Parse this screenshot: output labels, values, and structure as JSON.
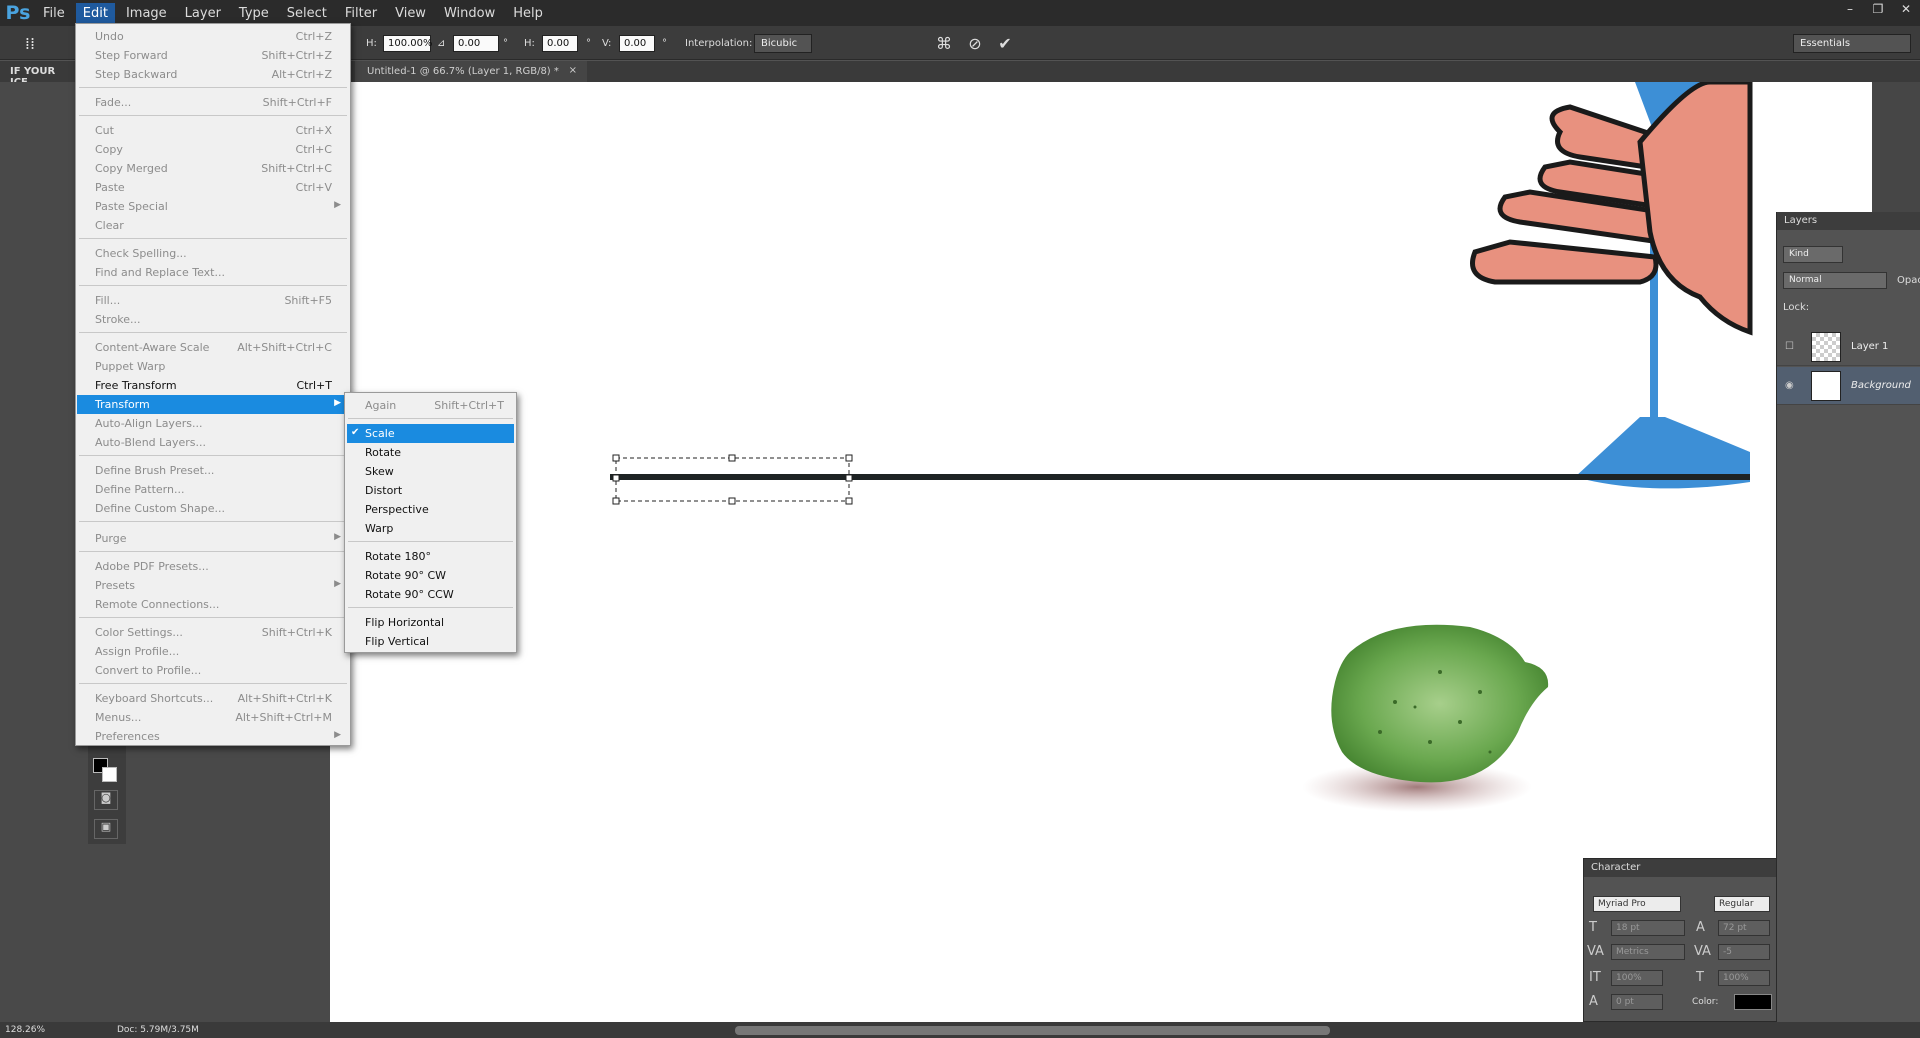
{
  "menubar": {
    "logo": "Ps",
    "items": [
      "File",
      "Edit",
      "Image",
      "Layer",
      "Type",
      "Select",
      "Filter",
      "View",
      "Window",
      "Help"
    ],
    "active": "Edit",
    "window_controls": [
      "–",
      "❐",
      "✕"
    ]
  },
  "options": {
    "h_label": "H:",
    "h_value": "100.00%",
    "angle_symbol": "⊿",
    "angle_value": "0.00",
    "degree": "°",
    "hskew_label": "H:",
    "hskew_value": "0.00",
    "vskew_label": "V:",
    "vskew_value": "0.00",
    "interpolation_label": "Interpolation:",
    "interpolation_value": "Bicubic",
    "workspace": "Essentials"
  },
  "left_panel_title": "IF YOUR ICE",
  "document_tab": "Untitled-1 @ 66.7% (Layer 1, RGB/8) *",
  "document_tab_close": "×",
  "edit_menu": {
    "items": [
      {
        "label": "Undo",
        "shortcut": "Ctrl+Z"
      },
      {
        "label": "Step Forward",
        "shortcut": "Shift+Ctrl+Z"
      },
      {
        "label": "Step Backward",
        "shortcut": "Alt+Ctrl+Z"
      },
      {
        "label": "Fade...",
        "shortcut": "Shift+Ctrl+F"
      },
      {
        "label": "Cut",
        "shortcut": "Ctrl+X"
      },
      {
        "label": "Copy",
        "shortcut": "Ctrl+C"
      },
      {
        "label": "Copy Merged",
        "shortcut": "Shift+Ctrl+C"
      },
      {
        "label": "Paste",
        "shortcut": "Ctrl+V"
      },
      {
        "label": "Paste Special",
        "shortcut": ""
      },
      {
        "label": "Clear",
        "shortcut": ""
      },
      {
        "label": "Check Spelling...",
        "shortcut": ""
      },
      {
        "label": "Find and Replace Text...",
        "shortcut": ""
      },
      {
        "label": "Fill...",
        "shortcut": "Shift+F5"
      },
      {
        "label": "Stroke...",
        "shortcut": ""
      },
      {
        "label": "Content-Aware Scale",
        "shortcut": "Alt+Shift+Ctrl+C"
      },
      {
        "label": "Puppet Warp",
        "shortcut": ""
      },
      {
        "label": "Free Transform",
        "shortcut": "Ctrl+T"
      },
      {
        "label": "Transform",
        "shortcut": ""
      },
      {
        "label": "Auto-Align Layers...",
        "shortcut": ""
      },
      {
        "label": "Auto-Blend Layers...",
        "shortcut": ""
      },
      {
        "label": "Define Brush Preset...",
        "shortcut": ""
      },
      {
        "label": "Define Pattern...",
        "shortcut": ""
      },
      {
        "label": "Define Custom Shape...",
        "shortcut": ""
      },
      {
        "label": "Purge",
        "shortcut": ""
      },
      {
        "label": "Adobe PDF Presets...",
        "shortcut": ""
      },
      {
        "label": "Presets",
        "shortcut": ""
      },
      {
        "label": "Remote Connections...",
        "shortcut": ""
      },
      {
        "label": "Color Settings...",
        "shortcut": "Shift+Ctrl+K"
      },
      {
        "label": "Assign Profile...",
        "shortcut": ""
      },
      {
        "label": "Convert to Profile...",
        "shortcut": ""
      },
      {
        "label": "Keyboard Shortcuts...",
        "shortcut": "Alt+Shift+Ctrl+K"
      },
      {
        "label": "Menus...",
        "shortcut": "Alt+Shift+Ctrl+M"
      },
      {
        "label": "Preferences",
        "shortcut": ""
      }
    ]
  },
  "transform_menu": {
    "items": [
      {
        "label": "Again",
        "shortcut": "Shift+Ctrl+T"
      },
      {
        "label": "Scale",
        "shortcut": ""
      },
      {
        "label": "Rotate",
        "shortcut": ""
      },
      {
        "label": "Skew",
        "shortcut": ""
      },
      {
        "label": "Distort",
        "shortcut": ""
      },
      {
        "label": "Perspective",
        "shortcut": ""
      },
      {
        "label": "Warp",
        "shortcut": ""
      },
      {
        "label": "Rotate 180°",
        "shortcut": ""
      },
      {
        "label": "Rotate 90° CW",
        "shortcut": ""
      },
      {
        "label": "Rotate 90° CCW",
        "shortcut": ""
      },
      {
        "label": "Flip Horizontal",
        "shortcut": ""
      },
      {
        "label": "Flip Vertical",
        "shortcut": ""
      }
    ],
    "checked": "Scale"
  },
  "layers_panel": {
    "title": "Layers",
    "kind": "Kind",
    "blend_mode": "Normal",
    "opacity_label": "Opac",
    "lock_label": "Lock:",
    "layers": [
      {
        "name": "Layer 1",
        "visible": false
      },
      {
        "name": "Background",
        "visible": true
      }
    ]
  },
  "character_panel": {
    "title": "Character",
    "font": "Myriad Pro",
    "style": "Regular",
    "size": "18 pt",
    "leading": "72 pt",
    "kerning": "Metrics",
    "tracking": "-5",
    "vscale": "100%",
    "hscale": "100%",
    "baseline": "0 pt",
    "color_label": "Color:"
  },
  "status": {
    "zoom": "128.26%",
    "doc": "Doc: 5.79M/3.75M"
  },
  "colors": {
    "accent": "#1a8be0",
    "lime": "#6aa84f",
    "glass": "#3d8fd6",
    "hand": "#e8917f"
  }
}
